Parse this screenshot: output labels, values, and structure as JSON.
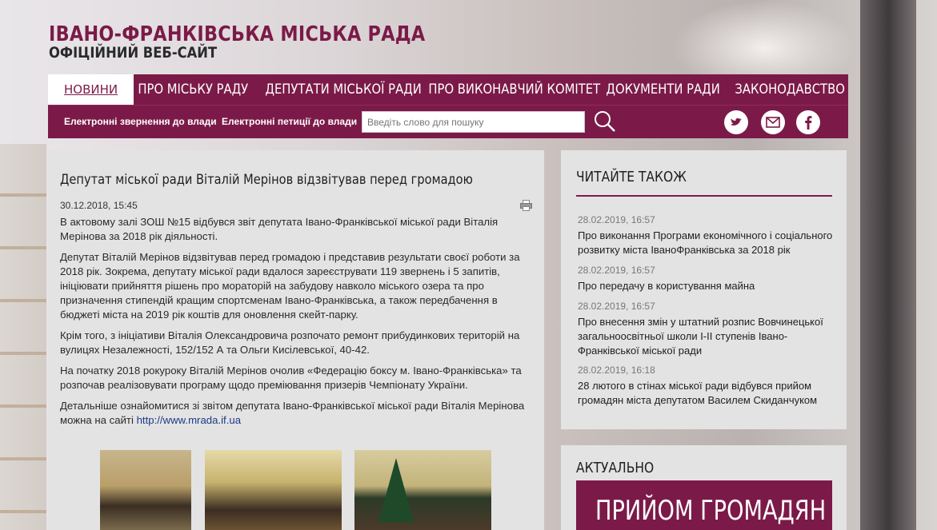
{
  "header": {
    "title": "ІВАНО-ФРАНКІВСЬКА МІСЬКА РАДА",
    "subtitle": "ОФІЦІЙНИЙ ВЕБ-САЙТ"
  },
  "nav": {
    "items": [
      "НОВИНИ",
      "ПРО МІСЬКУ РАДУ",
      "ДЕПУТАТИ МІСЬКОЇ РАДИ",
      "ПРО ВИКОНАВЧИЙ КОМІТЕТ",
      "ДОКУМЕНТИ РАДИ",
      "ЗАКОНОДАВСТВО"
    ]
  },
  "subnav": {
    "appeals": "Електронні звернення до влади",
    "petitions": "Електронні петиції до влади",
    "search_placeholder": "Введіть слово для пошуку"
  },
  "icons": {
    "search": "search-icon",
    "twitter": "twitter-icon",
    "email": "email-icon",
    "facebook": "facebook-icon",
    "print": "print-icon"
  },
  "colors": {
    "brand": "#7b1a48",
    "panel": "#e4e3e3"
  },
  "article": {
    "title": "Депутат міської ради Віталій Мерінов відзвітував перед громадою",
    "date": "30.12.2018, 15:45",
    "paragraphs": [
      "В актовому залі ЗОШ №15 відбувся звіт депутата Івано-Франківської міської ради Віталія Мерінова за 2018 рік діяльності.",
      "Депутат Віталій Мерінов відзвітував перед громадою і представив результати своєї роботи за 2018 рік. Зокрема, депутату міської ради вдалося зареєструвати 119 звернень і 5 запитів, ініціювати прийняття рішень про мораторій на забудову навколо міського озера та про призначення стипендій кращим спортсменам Івано-Франківська, а також передбачення в бюджеті міста на 2019 рік коштів для оновлення скейт-парку.",
      "Крім того, з ініціативи Віталія Олександровича розпочато ремонт прибудинкових територій на вулицях Незалежності, 152/152 А та Ольги Кисілевської, 40-42.",
      "На початку 2018 рокуроку Віталій Мерінов очолив «Федерацію боксу м. Івано-Франківська» та розпочав реалізовувати програму щодо преміювання призерів Чемпіонату України."
    ],
    "more_text": "Детальніше ознайомитися зі звітом депутата Івано-Франківської міської ради Віталія Мерінова можна на сайті",
    "more_link": "http://www.mrada.if.ua"
  },
  "read_also": {
    "heading": "ЧИТАЙТЕ ТАКОЖ",
    "items": [
      {
        "date": "28.02.2019, 16:57",
        "title": "Про виконання Програми економічного і соціального розвитку міста ІваноФранківська за 2018 рік"
      },
      {
        "date": "28.02.2019, 16:57",
        "title": "Про передачу в користування майна"
      },
      {
        "date": "28.02.2019, 16:57",
        "title": "Про внесення змін у штатний розпис Вовчинецької загальноосвітньої школи І-ІІ ступенів Івано-Франківської міської ради"
      },
      {
        "date": "28.02.2019, 16:18",
        "title": "28 лютого в стінах міської ради відбувся прийом громадян міста депутатом Василем Скиданчуком"
      }
    ]
  },
  "actual": {
    "heading": "АКТУАЛЬНО",
    "banner": "ПРИЙОМ ГРОМАДЯН"
  }
}
